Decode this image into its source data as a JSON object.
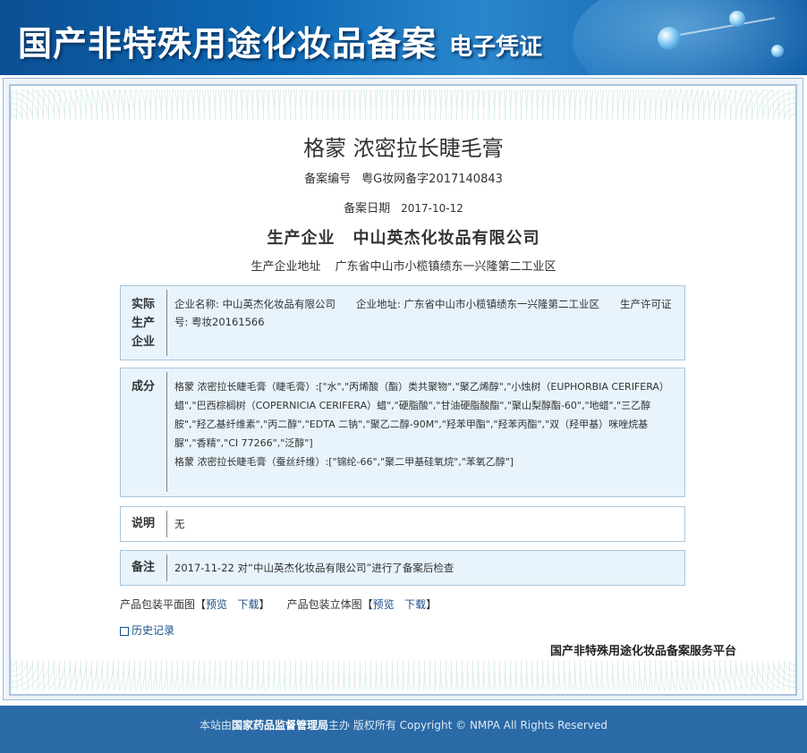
{
  "banner": {
    "title": "国产非特殊用途化妆品备案",
    "subtitle": "电子凭证"
  },
  "product": {
    "name": "格蒙 浓密拉长睫毛膏",
    "reg_label": "备案编号",
    "reg_value": "粤G妆网备字2017140843",
    "date_label": "备案日期",
    "date_value": "2017-10-12",
    "mfr_label": "生产企业",
    "mfr_value": "中山英杰化妆品有限公司",
    "addr_label": "生产企业地址",
    "addr_value": "广东省中山市小榄镇绩东一兴隆第二工业区"
  },
  "sections": {
    "actual": {
      "label_lines": [
        "实际",
        "生产",
        "企业"
      ],
      "text": "企业名称: 中山英杰化妆品有限公司　　企业地址: 广东省中山市小榄镇绩东一兴隆第二工业区　　生产许可证号: 粤妆20161566"
    },
    "ingredients": {
      "label": "成分",
      "lines": [
        "格蒙 浓密拉长睫毛膏（睫毛膏）:[\"水\",\"丙烯酸（酯）类共聚物\",\"聚乙烯醇\",\"小烛树（EUPHORBIA CERIFERA）蜡\",\"巴西棕榈树（COPERNICIA CERIFERA）蜡\",\"硬脂酸\",\"甘油硬脂酸酯\",\"聚山梨醇酯-60\",\"地蜡\",\"三乙醇胺\",\"羟乙基纤维素\",\"丙二醇\",\"EDTA 二钠\",\"聚乙二醇-90M\",\"羟苯甲酯\",\"羟苯丙酯\",\"双（羟甲基）咪唑烷基脲\",\"香精\",\"CI 77266\",\"泛醇\"]",
        "格蒙 浓密拉长睫毛膏（蚕丝纤维）:[\"锦纶-66\",\"聚二甲基硅氧烷\",\"苯氧乙醇\"]"
      ]
    },
    "note": {
      "label": "说明",
      "text": "无"
    },
    "remark": {
      "label": "备注",
      "text": "2017-11-22 对“中山英杰化妆品有限公司”进行了备案后检查"
    }
  },
  "links": {
    "flat_label": "产品包装平面图",
    "solid_label": "产品包装立体图",
    "preview": "预览",
    "download": "下载",
    "lb": "【",
    "rb": "】",
    "history": "历史记录"
  },
  "platform": "国产非特殊用途化妆品备案服务平台",
  "footer": {
    "pre": "本站由",
    "org": "国家药品监督管理局",
    "post": "主办 版权所有 Copyright © NMPA All Rights Reserved"
  }
}
